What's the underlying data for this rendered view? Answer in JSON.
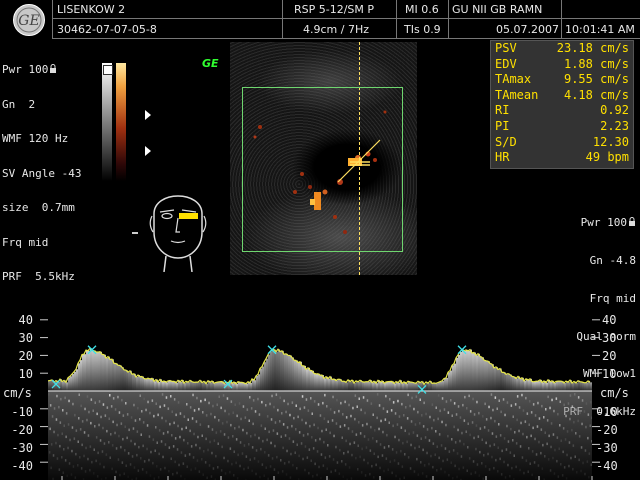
{
  "header": {
    "logo_text": "GE",
    "patient_name": "LISENKOW 2",
    "patient_id": "30462-07-07-05-8",
    "probe": "RSP 5-12/SM P",
    "depth_freq": "4.9cm / 7Hz",
    "mi": "MI  0.6",
    "tis": "TIs  0.9",
    "institution": "GU NII GB RAMN",
    "date": "05.07.2007",
    "time": "10:01:41 AM"
  },
  "left_params": [
    "Pwr 100",
    "Gn  2",
    "WMF 120 Hz",
    "SV Angle -43",
    "size  0.7mm",
    "Frq mid",
    "PRF  5.5kHz"
  ],
  "ge_watermark": "GE",
  "measurements": [
    {
      "label": "PSV",
      "value": "23.18 cm/s"
    },
    {
      "label": "EDV",
      "value": "1.88 cm/s"
    },
    {
      "label": "TAmax",
      "value": "9.55 cm/s"
    },
    {
      "label": "TAmean",
      "value": "4.18 cm/s"
    },
    {
      "label": "RI",
      "value": "0.92"
    },
    {
      "label": "PI",
      "value": "2.23"
    },
    {
      "label": "S/D",
      "value": "12.30"
    },
    {
      "label": "HR",
      "value": "49 bpm"
    }
  ],
  "right_params": [
    "Pwr 100",
    "Gn -4.8",
    "Frq mid",
    "Qual norm",
    "WMF low1",
    "PRF  0.6kHz"
  ],
  "spectral": {
    "unit": "cm/s",
    "ticks": [
      "40",
      "30",
      "20",
      "10",
      "-10",
      "-20",
      "-30",
      "-40"
    ],
    "tick_values": [
      40,
      30,
      20,
      10,
      -10,
      -20,
      -30,
      -40
    ],
    "range": [
      -45,
      45
    ],
    "baseline": 0
  },
  "colors": {
    "background": "#000000",
    "text": "#e8e8e8",
    "measure_text": "#ffe000",
    "roi_box": "#6fd66f",
    "envelope": "#e6e64a"
  }
}
